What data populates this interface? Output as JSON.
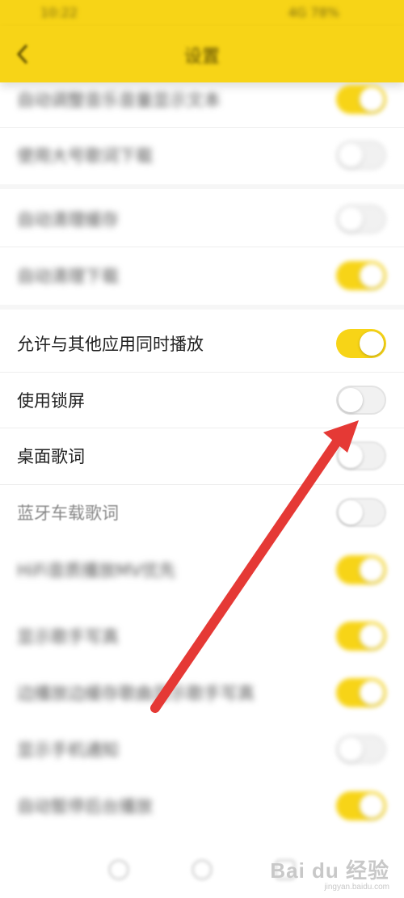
{
  "status_bar": {
    "left_text": "10:22",
    "right_text": "4G 78%"
  },
  "header": {
    "title": "设置"
  },
  "settings": [
    {
      "label": "自动调整音乐音量显示文本",
      "state": "on"
    },
    {
      "label": "使用大号歌词下载",
      "state": "off"
    },
    {
      "label": "自动清理缓存",
      "state": "off"
    },
    {
      "label": "自动清理下载",
      "state": "on"
    },
    {
      "label": "允许与其他应用同时播放",
      "state": "on"
    },
    {
      "label": "使用锁屏",
      "state": "off"
    },
    {
      "label": "桌面歌词",
      "state": "off"
    },
    {
      "label": "蓝牙车载歌词",
      "state": "off"
    },
    {
      "label": "HiFi音质播放MV优先",
      "state": "on"
    },
    {
      "label": "显示歌手写真",
      "state": "on"
    },
    {
      "label": "边播放边缓存歌曲显示歌手写真",
      "state": "on"
    },
    {
      "label": "显示手机通知",
      "state": "off"
    },
    {
      "label": "自动暂停后台播放",
      "state": "on"
    }
  ],
  "watermark": {
    "brand": "Bai du 经验",
    "site": "jingyan.baidu.com"
  },
  "colors": {
    "accent": "#f7d417",
    "arrow": "#e53935"
  }
}
